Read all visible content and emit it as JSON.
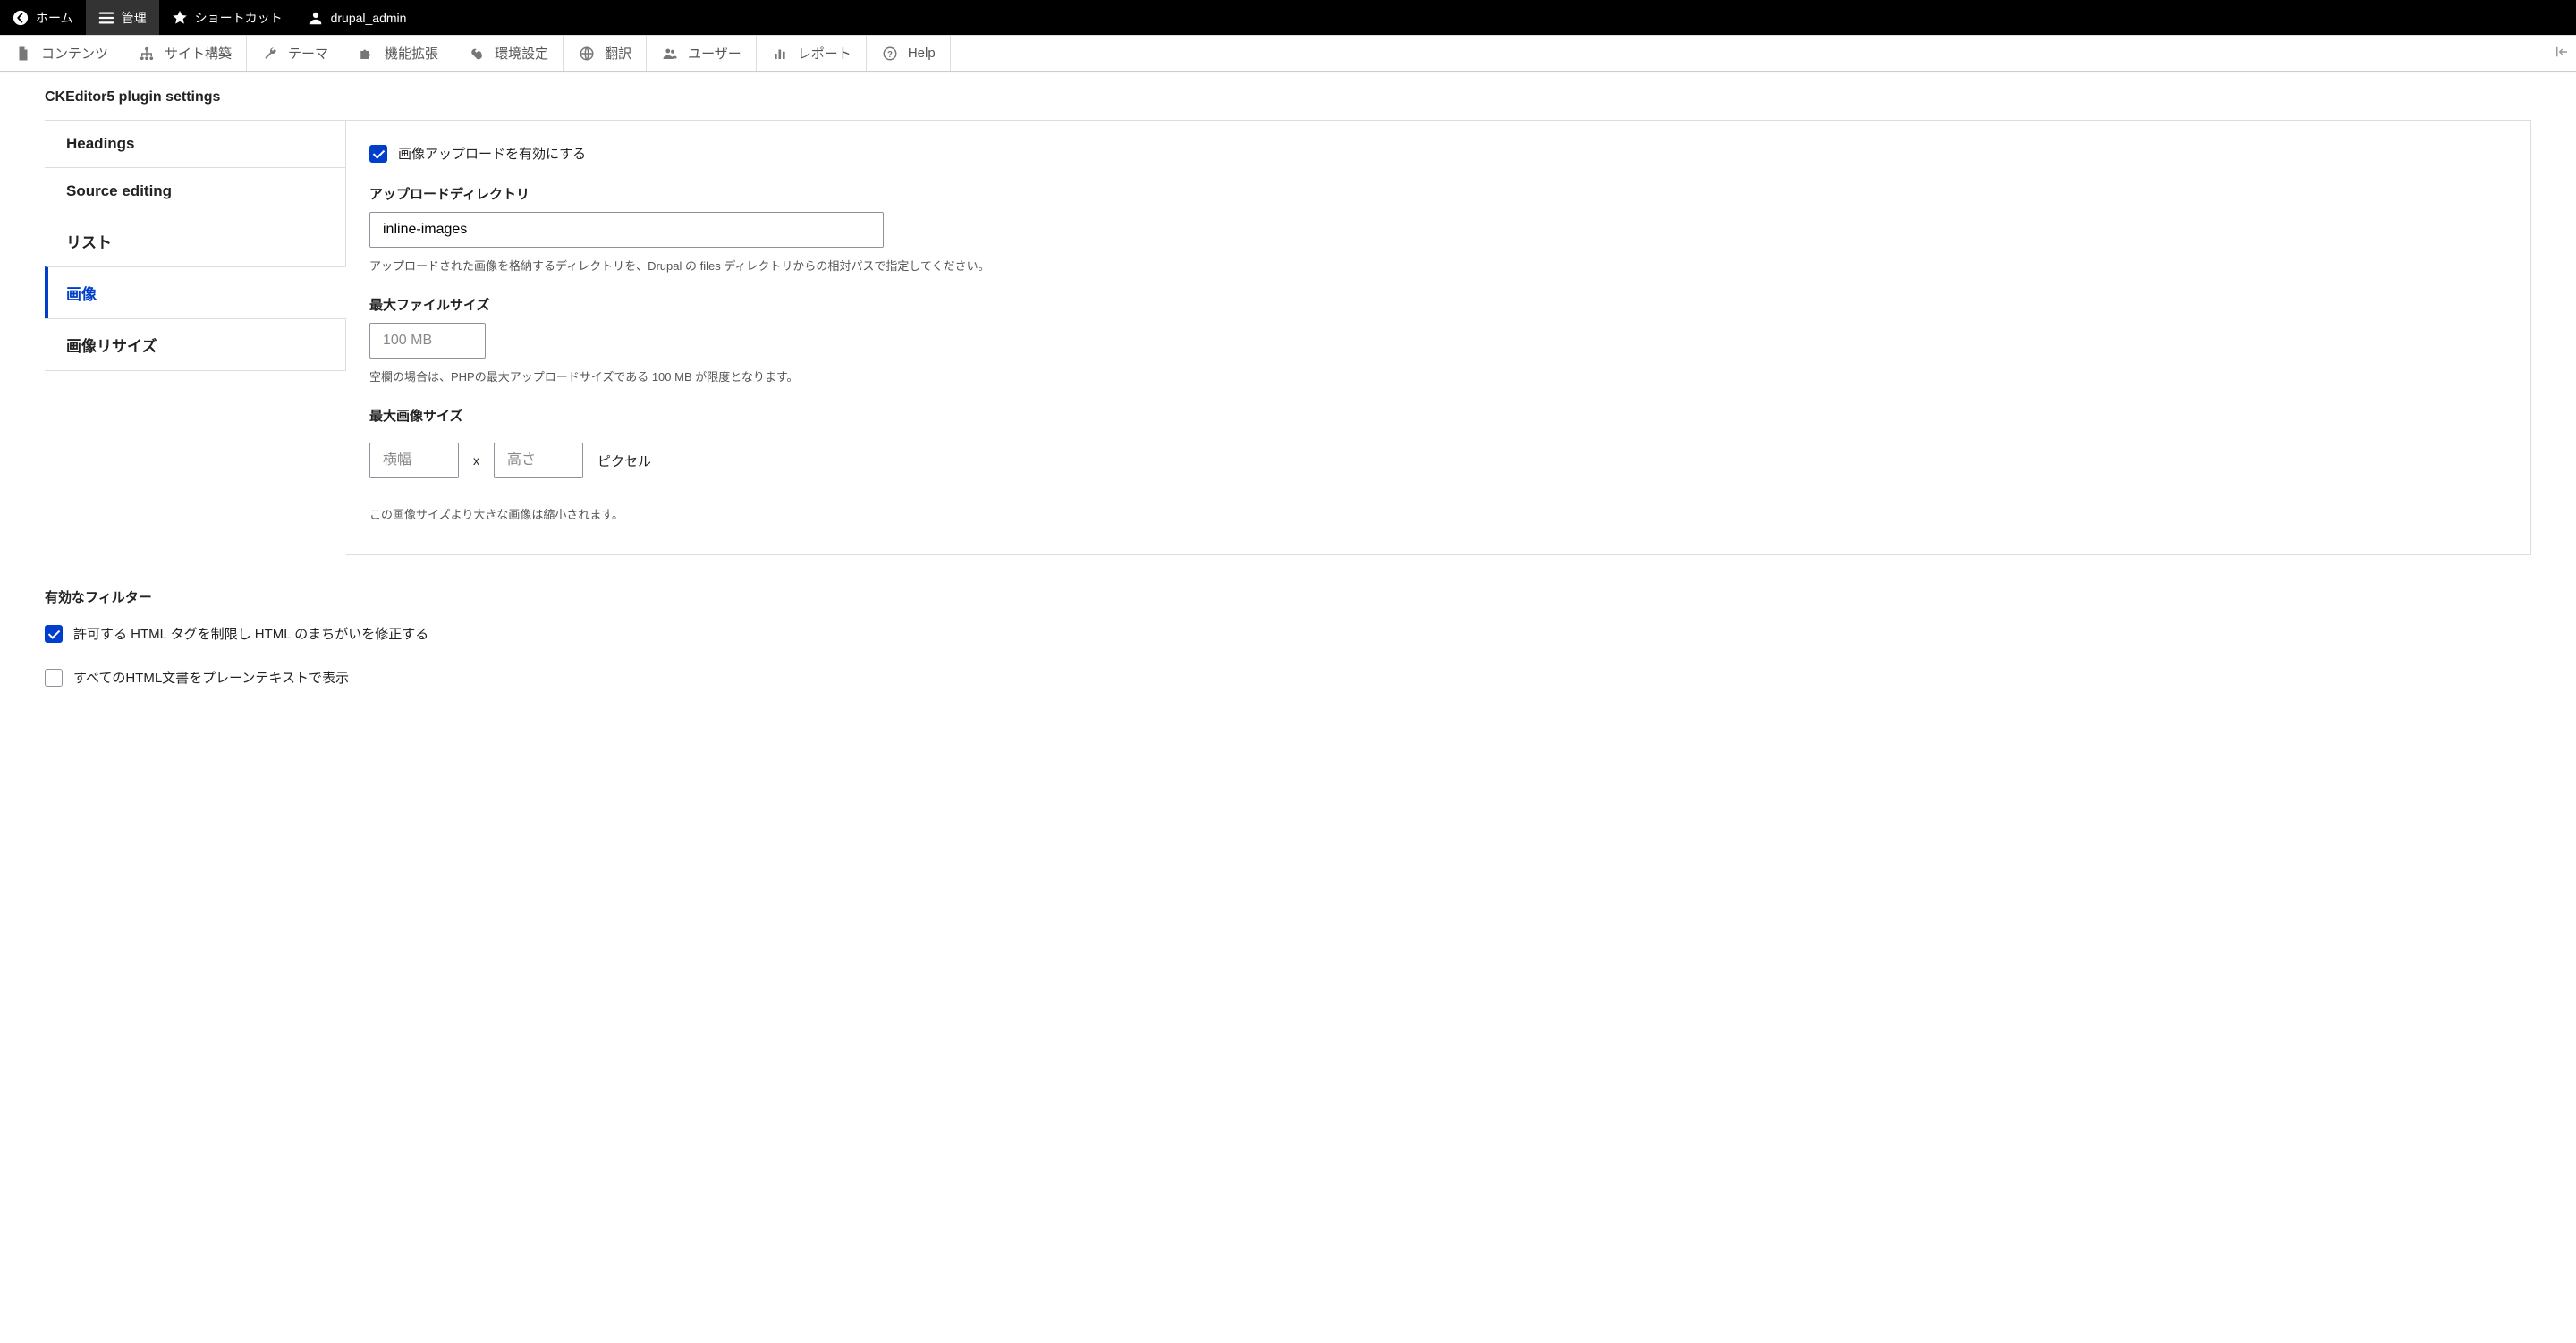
{
  "topbar": {
    "home": "ホーム",
    "manage": "管理",
    "shortcuts": "ショートカット",
    "user": "drupal_admin"
  },
  "admintabs": {
    "content": "コンテンツ",
    "structure": "サイト構築",
    "appearance": "テーマ",
    "extend": "機能拡張",
    "config": "環境設定",
    "translate": "翻訳",
    "people": "ユーザー",
    "reports": "レポート",
    "help": "Help"
  },
  "plugin_settings": {
    "title": "CKEditor5 plugin settings",
    "tabs": {
      "headings": "Headings",
      "source": "Source editing",
      "list": "リスト",
      "image": "画像",
      "resize": "画像リサイズ"
    },
    "image_panel": {
      "enable_upload_label": "画像アップロードを有効にする",
      "upload_dir_label": "アップロードディレクトリ",
      "upload_dir_value": "inline-images",
      "upload_dir_help": "アップロードされた画像を格納するディレクトリを、Drupal の files ディレクトリからの相対パスで指定してください。",
      "max_filesize_label": "最大ファイルサイズ",
      "max_filesize_placeholder": "100 MB",
      "max_filesize_help": "空欄の場合は、PHPの最大アップロードサイズである 100 MB が限度となります。",
      "max_dim_label": "最大画像サイズ",
      "width_placeholder": "横幅",
      "height_placeholder": "高さ",
      "dim_x": "x",
      "dim_unit": "ピクセル",
      "dim_help": "この画像サイズより大きな画像は縮小されます。"
    }
  },
  "filters": {
    "title": "有効なフィルター",
    "limit_html": "許可する HTML タグを制限し HTML のまちがいを修正する",
    "plain_text": "すべてのHTML文書をプレーンテキストで表示"
  }
}
